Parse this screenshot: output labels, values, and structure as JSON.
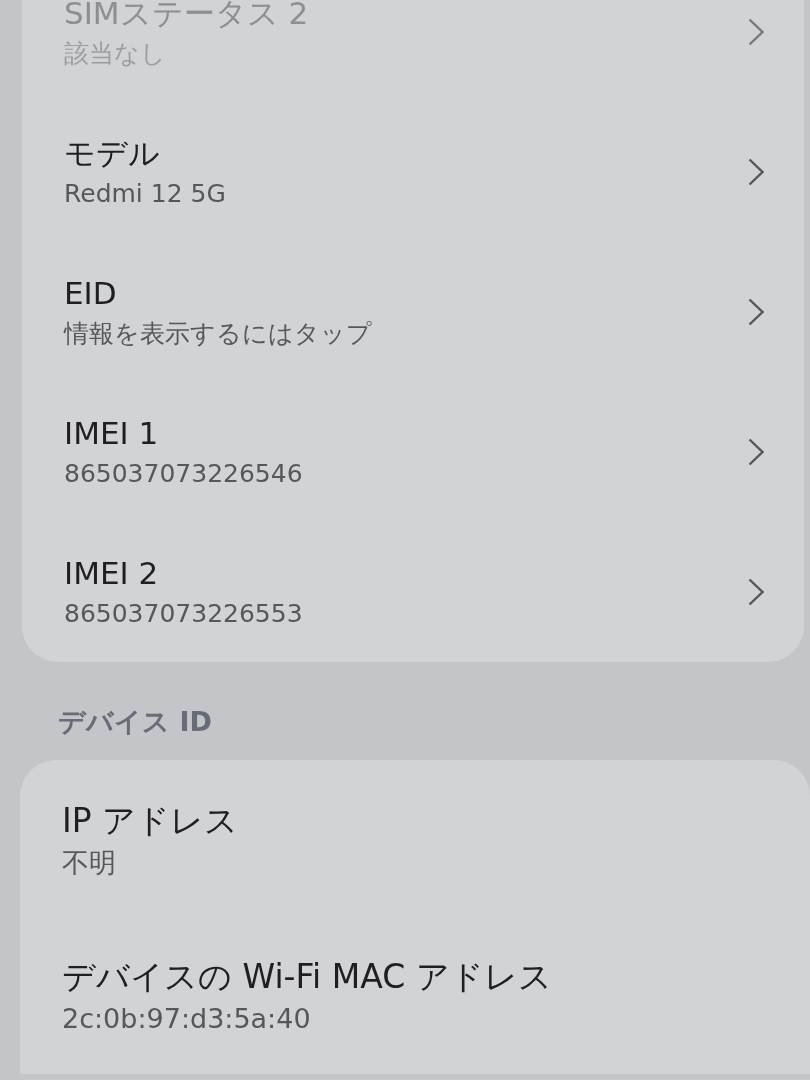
{
  "sections": [
    {
      "rows": [
        {
          "kind": "link",
          "title": "SIMステータス 2",
          "value": "該当なし",
          "disabled": true
        },
        {
          "kind": "link",
          "title": "モデル",
          "value": "Redmi 12 5G",
          "disabled": false
        },
        {
          "kind": "link",
          "title": "EID",
          "value": "情報を表示するにはタップ",
          "disabled": false
        },
        {
          "kind": "link",
          "title": "IMEI 1",
          "value": "865037073226546",
          "disabled": false
        },
        {
          "kind": "link",
          "title": "IMEI 2",
          "value": "865037073226553",
          "disabled": false
        }
      ]
    },
    {
      "header": "デバイス ID",
      "rows": [
        {
          "kind": "info",
          "title": "IP アドレス",
          "value": "不明",
          "disabled": false
        },
        {
          "kind": "info",
          "title": "デバイスの Wi-Fi MAC アドレス",
          "value": "2c:0b:97:d3:5a:40",
          "disabled": false
        }
      ]
    }
  ]
}
